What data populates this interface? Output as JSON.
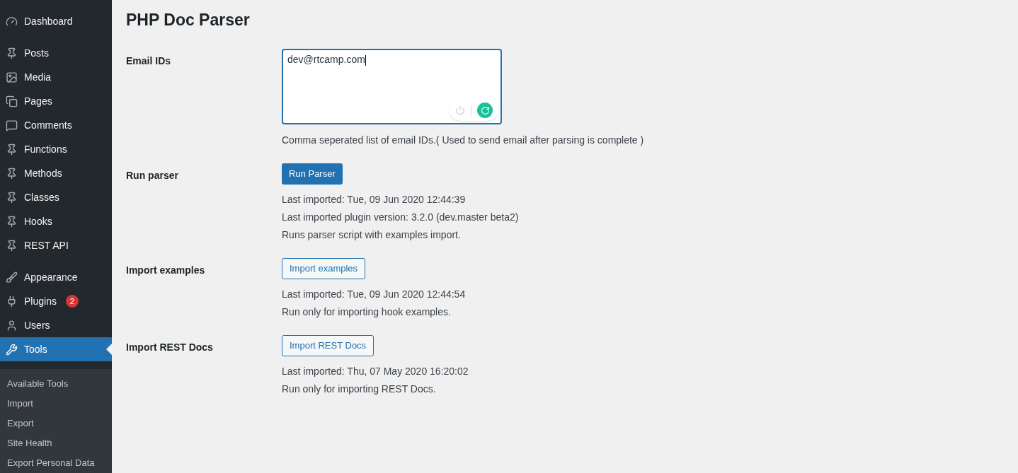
{
  "sidebar": {
    "groups": [
      [
        {
          "label": "Dashboard",
          "selected": false
        }
      ],
      [
        {
          "label": "Posts",
          "selected": false
        },
        {
          "label": "Media",
          "selected": false
        },
        {
          "label": "Pages",
          "selected": false
        },
        {
          "label": "Comments",
          "selected": false
        },
        {
          "label": "Functions",
          "selected": false
        },
        {
          "label": "Methods",
          "selected": false
        },
        {
          "label": "Classes",
          "selected": false
        },
        {
          "label": "Hooks",
          "selected": false
        },
        {
          "label": "REST API",
          "selected": false
        }
      ],
      [
        {
          "label": "Appearance",
          "selected": false
        },
        {
          "label": "Plugins",
          "selected": false,
          "badge": "2"
        },
        {
          "label": "Users",
          "selected": false
        },
        {
          "label": "Tools",
          "selected": true
        }
      ]
    ],
    "submenu": [
      "Available Tools",
      "Import",
      "Export",
      "Site Health",
      "Export Personal Data"
    ]
  },
  "page": {
    "title": "PHP Doc Parser",
    "rows": [
      {
        "label": "Email IDs",
        "kind": "textarea",
        "value": "dev@rtcamp.com",
        "notes": [
          "Comma seperated list of email IDs.( Used to send email after parsing is complete )"
        ]
      },
      {
        "label": "Run parser",
        "kind": "primary",
        "button": "Run Parser",
        "notes": [
          "Last imported: Tue, 09 Jun 2020 12:44:39",
          "Last imported plugin version: 3.2.0 (dev.master beta2)",
          "Runs parser script with examples import."
        ]
      },
      {
        "label": "Import examples",
        "kind": "secondary",
        "button": "Import examples",
        "notes": [
          "Last imported: Tue, 09 Jun 2020 12:44:54",
          "Run only for importing hook examples."
        ]
      },
      {
        "label": "Import REST Docs",
        "kind": "secondary",
        "button": "Import REST Docs",
        "notes": [
          "Last imported: Thu, 07 May 2020 16:20:02",
          "Run only for importing REST Docs."
        ]
      }
    ]
  }
}
